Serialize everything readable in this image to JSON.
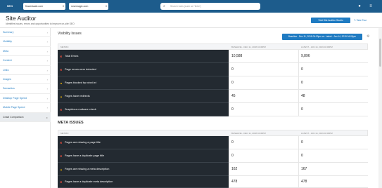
{
  "topbar": {
    "logo": "SEO",
    "domain": "flowerkaab.com",
    "competitor": "rosemagic.com",
    "search_placeholder": "Search tools (such as \"links\")"
  },
  "header": {
    "title": "Site Auditor",
    "subtitle": "Identifies issues, errors and opportunities to improve on-site SEO",
    "visit_button": "Visit Site Auditor Studio",
    "tour_link": "Take Tour"
  },
  "sidebar": {
    "items": [
      {
        "label": "Summary"
      },
      {
        "label": "Visibility"
      },
      {
        "label": "Meta"
      },
      {
        "label": "Content"
      },
      {
        "label": "Links"
      },
      {
        "label": "Images"
      },
      {
        "label": "Semantics"
      },
      {
        "label": "Desktop Page Speed"
      },
      {
        "label": "Mobile Page Speed"
      },
      {
        "label": "Crawl Comparison"
      }
    ]
  },
  "visibility": {
    "title": "Visibility Issues",
    "range_button": "Baseline - Dec 11, 2018 04:30pm vs. Latest - Jan 14, 2019 04:09pm",
    "headers": {
      "metric": "METRIC",
      "baseline": "BASELINE - DEC 11, 2018 04:30PM",
      "latest": "LATEST - JAN 14, 2019 04:09PM"
    },
    "rows": [
      {
        "name": "Total Errors",
        "icon": "error-icon",
        "baseline": "10,588",
        "latest": "9,896"
      },
      {
        "name": "Page errors were detected",
        "icon": "error-icon",
        "baseline": "0",
        "latest": "0"
      },
      {
        "name": "Pages blocked by robot.txt",
        "icon": "warning-icon",
        "baseline": "0",
        "latest": "0"
      },
      {
        "name": "Pages have redirects",
        "icon": "warning-icon",
        "baseline": "45",
        "latest": "48"
      },
      {
        "name": "Suspicious malware check",
        "icon": "error-icon",
        "baseline": "0",
        "latest": "0"
      }
    ]
  },
  "meta": {
    "title": "META ISSUES",
    "headers": {
      "metric": "METRIC",
      "baseline": "BASELINE - DEC 11, 2018 04:30PM",
      "latest": "LATEST - JAN 14, 2019 04:09PM"
    },
    "rows": [
      {
        "name": "Pages are missing a page title",
        "icon": "error-icon",
        "baseline": "0",
        "latest": "0"
      },
      {
        "name": "Pages have a duplicate page title",
        "icon": "error-icon",
        "baseline": "0",
        "latest": "0"
      },
      {
        "name": "Pages are missing a meta description",
        "icon": "warning-icon",
        "baseline": "162",
        "latest": "167"
      },
      {
        "name": "Pages have a duplicate meta description",
        "icon": "error-icon",
        "baseline": "478",
        "latest": "478"
      }
    ]
  }
}
